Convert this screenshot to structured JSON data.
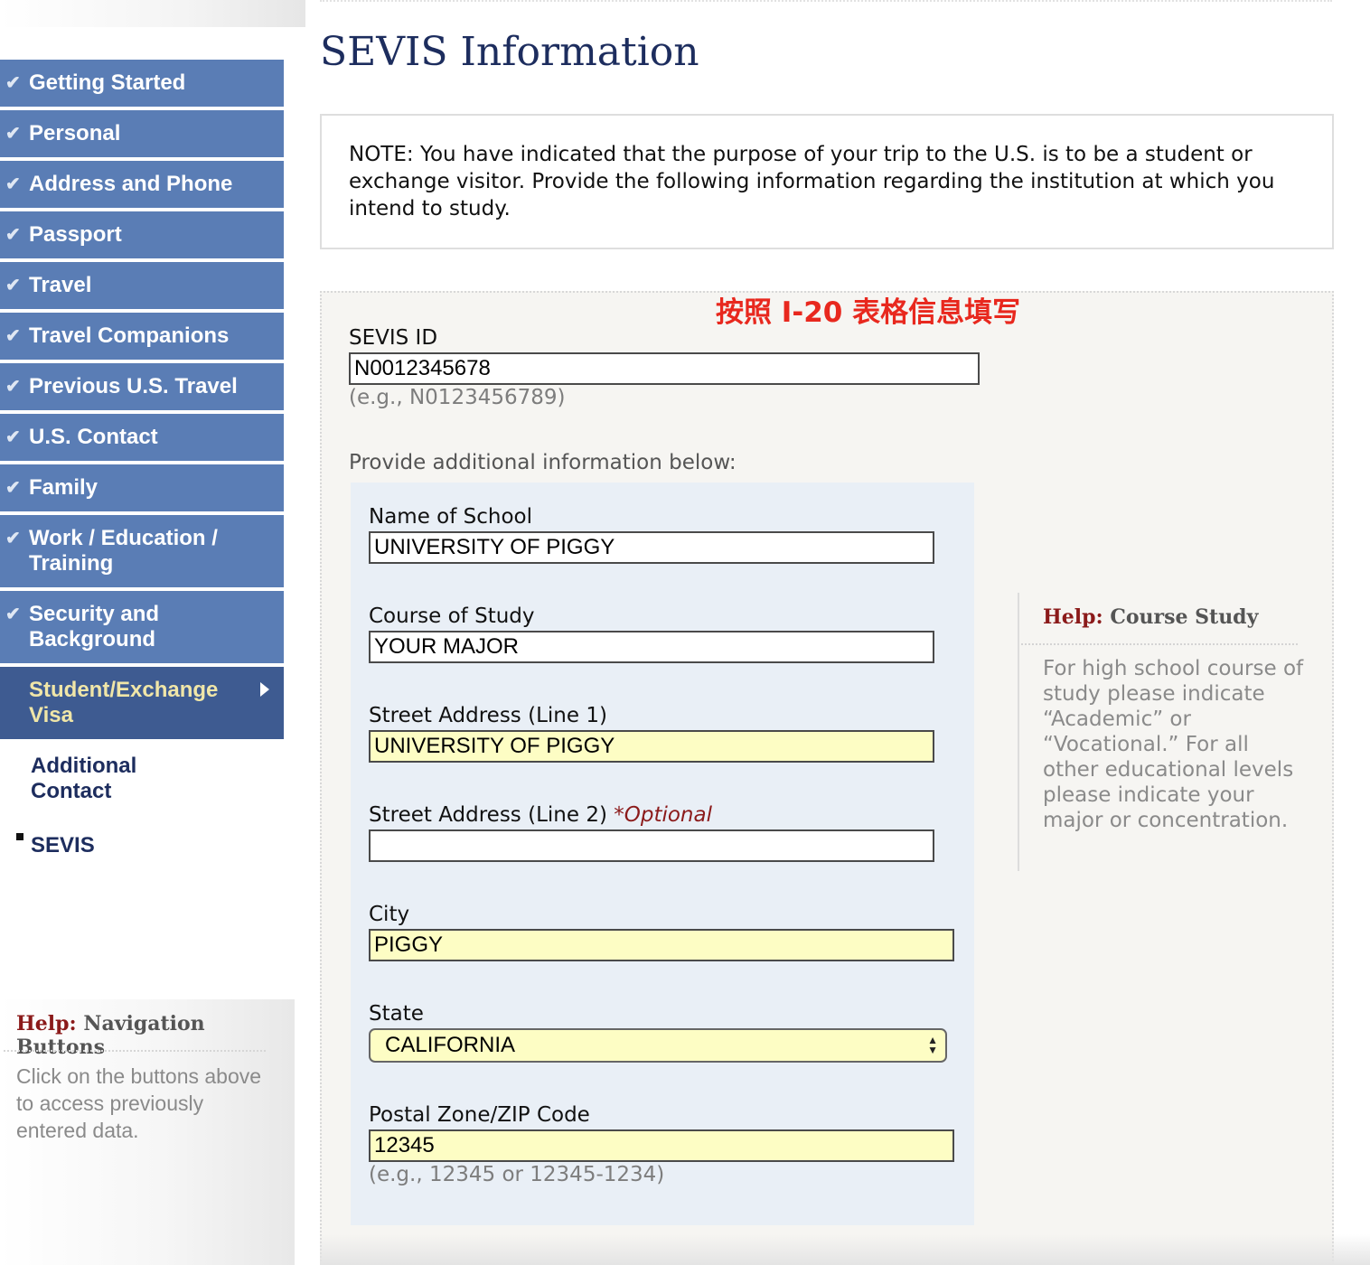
{
  "sidebar": {
    "items": [
      {
        "label": "Getting Started"
      },
      {
        "label": "Personal"
      },
      {
        "label": "Address and Phone"
      },
      {
        "label": "Passport"
      },
      {
        "label": "Travel"
      },
      {
        "label": "Travel Companions"
      },
      {
        "label": "Previous U.S. Travel"
      },
      {
        "label": "U.S. Contact"
      },
      {
        "label": "Family"
      },
      {
        "label": "Work / Education / Training"
      },
      {
        "label": "Security and Background"
      },
      {
        "label": "Student/Exchange Visa"
      }
    ],
    "subitems": [
      {
        "label": "Additional Contact"
      },
      {
        "label": "SEVIS"
      }
    ],
    "check_glyph": "✔",
    "help": {
      "title_prefix": "Help:",
      "title": "Navigation Buttons",
      "text": "Click on the buttons above to access previously entered data."
    }
  },
  "main": {
    "title": "SEVIS Information",
    "note": "NOTE: You have indicated that the purpose of your trip to the U.S. is to be a student or exchange visitor. Provide the following information regarding the institution at which you intend to study.",
    "annotation": "按照 I-20 表格信息填写",
    "sevis_id": {
      "label": "SEVIS ID",
      "value": "N0012345678",
      "hint": "(e.g., N0123456789)"
    },
    "additional_info_label": "Provide additional information below:",
    "school": {
      "name_label": "Name of School",
      "name_value": "UNIVERSITY OF PIGGY",
      "course_label": "Course of Study",
      "course_value": "YOUR MAJOR",
      "street1_label": "Street Address (Line 1)",
      "street1_value": "UNIVERSITY OF PIGGY",
      "street2_label": "Street Address (Line 2)",
      "street2_optional": "*Optional",
      "street2_value": "",
      "city_label": "City",
      "city_value": "PIGGY",
      "state_label": "State",
      "state_value": "CALIFORNIA",
      "zip_label": "Postal Zone/ZIP Code",
      "zip_value": "12345",
      "zip_hint": "(e.g., 12345 or 12345-1234)"
    },
    "help": {
      "title_prefix": "Help:",
      "title": "Course Study",
      "text": "For high school course of study please indicate “Academic” or “Vocational.” For all other educational levels please indicate your major or concentration."
    }
  },
  "colors": {
    "nav_bg": "#5a7db5",
    "nav_active_bg": "#3e5b91",
    "nav_active_text": "#f0e6a8",
    "title_navy": "#1d2d5e",
    "highlight_yellow": "#fdfdc4",
    "annotation_red": "#e8281e",
    "help_red": "#8b1a1a"
  }
}
